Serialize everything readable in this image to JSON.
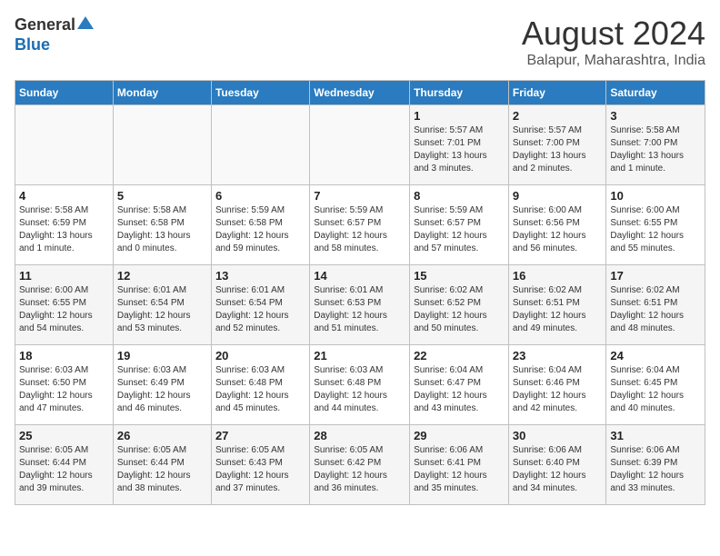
{
  "header": {
    "logo_general": "General",
    "logo_blue": "Blue",
    "month_year": "August 2024",
    "location": "Balapur, Maharashtra, India"
  },
  "weekdays": [
    "Sunday",
    "Monday",
    "Tuesday",
    "Wednesday",
    "Thursday",
    "Friday",
    "Saturday"
  ],
  "weeks": [
    [
      {
        "day": "",
        "info": ""
      },
      {
        "day": "",
        "info": ""
      },
      {
        "day": "",
        "info": ""
      },
      {
        "day": "",
        "info": ""
      },
      {
        "day": "1",
        "info": "Sunrise: 5:57 AM\nSunset: 7:01 PM\nDaylight: 13 hours\nand 3 minutes."
      },
      {
        "day": "2",
        "info": "Sunrise: 5:57 AM\nSunset: 7:00 PM\nDaylight: 13 hours\nand 2 minutes."
      },
      {
        "day": "3",
        "info": "Sunrise: 5:58 AM\nSunset: 7:00 PM\nDaylight: 13 hours\nand 1 minute."
      }
    ],
    [
      {
        "day": "4",
        "info": "Sunrise: 5:58 AM\nSunset: 6:59 PM\nDaylight: 13 hours\nand 1 minute."
      },
      {
        "day": "5",
        "info": "Sunrise: 5:58 AM\nSunset: 6:58 PM\nDaylight: 13 hours\nand 0 minutes."
      },
      {
        "day": "6",
        "info": "Sunrise: 5:59 AM\nSunset: 6:58 PM\nDaylight: 12 hours\nand 59 minutes."
      },
      {
        "day": "7",
        "info": "Sunrise: 5:59 AM\nSunset: 6:57 PM\nDaylight: 12 hours\nand 58 minutes."
      },
      {
        "day": "8",
        "info": "Sunrise: 5:59 AM\nSunset: 6:57 PM\nDaylight: 12 hours\nand 57 minutes."
      },
      {
        "day": "9",
        "info": "Sunrise: 6:00 AM\nSunset: 6:56 PM\nDaylight: 12 hours\nand 56 minutes."
      },
      {
        "day": "10",
        "info": "Sunrise: 6:00 AM\nSunset: 6:55 PM\nDaylight: 12 hours\nand 55 minutes."
      }
    ],
    [
      {
        "day": "11",
        "info": "Sunrise: 6:00 AM\nSunset: 6:55 PM\nDaylight: 12 hours\nand 54 minutes."
      },
      {
        "day": "12",
        "info": "Sunrise: 6:01 AM\nSunset: 6:54 PM\nDaylight: 12 hours\nand 53 minutes."
      },
      {
        "day": "13",
        "info": "Sunrise: 6:01 AM\nSunset: 6:54 PM\nDaylight: 12 hours\nand 52 minutes."
      },
      {
        "day": "14",
        "info": "Sunrise: 6:01 AM\nSunset: 6:53 PM\nDaylight: 12 hours\nand 51 minutes."
      },
      {
        "day": "15",
        "info": "Sunrise: 6:02 AM\nSunset: 6:52 PM\nDaylight: 12 hours\nand 50 minutes."
      },
      {
        "day": "16",
        "info": "Sunrise: 6:02 AM\nSunset: 6:51 PM\nDaylight: 12 hours\nand 49 minutes."
      },
      {
        "day": "17",
        "info": "Sunrise: 6:02 AM\nSunset: 6:51 PM\nDaylight: 12 hours\nand 48 minutes."
      }
    ],
    [
      {
        "day": "18",
        "info": "Sunrise: 6:03 AM\nSunset: 6:50 PM\nDaylight: 12 hours\nand 47 minutes."
      },
      {
        "day": "19",
        "info": "Sunrise: 6:03 AM\nSunset: 6:49 PM\nDaylight: 12 hours\nand 46 minutes."
      },
      {
        "day": "20",
        "info": "Sunrise: 6:03 AM\nSunset: 6:48 PM\nDaylight: 12 hours\nand 45 minutes."
      },
      {
        "day": "21",
        "info": "Sunrise: 6:03 AM\nSunset: 6:48 PM\nDaylight: 12 hours\nand 44 minutes."
      },
      {
        "day": "22",
        "info": "Sunrise: 6:04 AM\nSunset: 6:47 PM\nDaylight: 12 hours\nand 43 minutes."
      },
      {
        "day": "23",
        "info": "Sunrise: 6:04 AM\nSunset: 6:46 PM\nDaylight: 12 hours\nand 42 minutes."
      },
      {
        "day": "24",
        "info": "Sunrise: 6:04 AM\nSunset: 6:45 PM\nDaylight: 12 hours\nand 40 minutes."
      }
    ],
    [
      {
        "day": "25",
        "info": "Sunrise: 6:05 AM\nSunset: 6:44 PM\nDaylight: 12 hours\nand 39 minutes."
      },
      {
        "day": "26",
        "info": "Sunrise: 6:05 AM\nSunset: 6:44 PM\nDaylight: 12 hours\nand 38 minutes."
      },
      {
        "day": "27",
        "info": "Sunrise: 6:05 AM\nSunset: 6:43 PM\nDaylight: 12 hours\nand 37 minutes."
      },
      {
        "day": "28",
        "info": "Sunrise: 6:05 AM\nSunset: 6:42 PM\nDaylight: 12 hours\nand 36 minutes."
      },
      {
        "day": "29",
        "info": "Sunrise: 6:06 AM\nSunset: 6:41 PM\nDaylight: 12 hours\nand 35 minutes."
      },
      {
        "day": "30",
        "info": "Sunrise: 6:06 AM\nSunset: 6:40 PM\nDaylight: 12 hours\nand 34 minutes."
      },
      {
        "day": "31",
        "info": "Sunrise: 6:06 AM\nSunset: 6:39 PM\nDaylight: 12 hours\nand 33 minutes."
      }
    ]
  ]
}
